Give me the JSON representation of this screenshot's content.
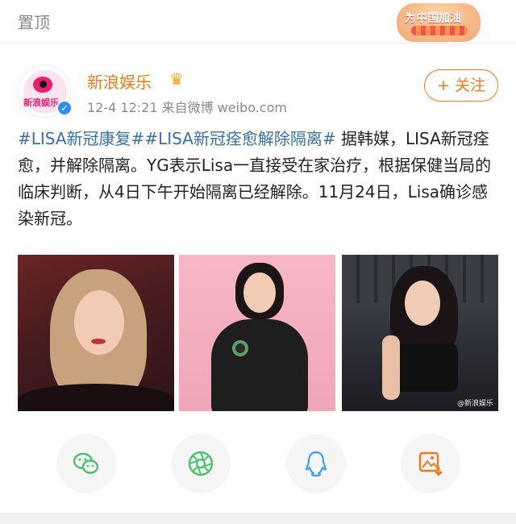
{
  "topbar": {
    "pin_label": "置顶",
    "badge_text": "为中国加油"
  },
  "author": {
    "name": "新浪娱乐",
    "avatar_text": "新浪娱乐",
    "verified_icon": "verified-check-icon",
    "crown_icon": "crown-icon",
    "meta": "12-4 12:21  来自微博 weibo.com",
    "follow_label": "+ 关注"
  },
  "post": {
    "tag1": "#LISA新冠康复#",
    "tag2": "#LISA新冠痊愈解除隔离#",
    "body": " 据韩媒，LISA新冠痊愈，并解除隔离。YG表示Lisa一直接受在家治疗，根据保健当局的临床判断，从4日下午开始隔离已经解除。11月24日，Lisa确诊感染新冠。"
  },
  "photos": {
    "watermark": "@新浪娱乐"
  },
  "share": {
    "items": [
      {
        "icon": "wechat-icon",
        "color": "#4cc26a"
      },
      {
        "icon": "moments-icon",
        "color": "#4cc26a"
      },
      {
        "icon": "qq-icon",
        "color": "#3aa0f0"
      },
      {
        "icon": "save-image-icon",
        "color": "#f07a1a"
      }
    ]
  },
  "colors": {
    "accent": "#f07a1a",
    "link": "#3a6ea8",
    "meta": "#8a8a8a"
  }
}
